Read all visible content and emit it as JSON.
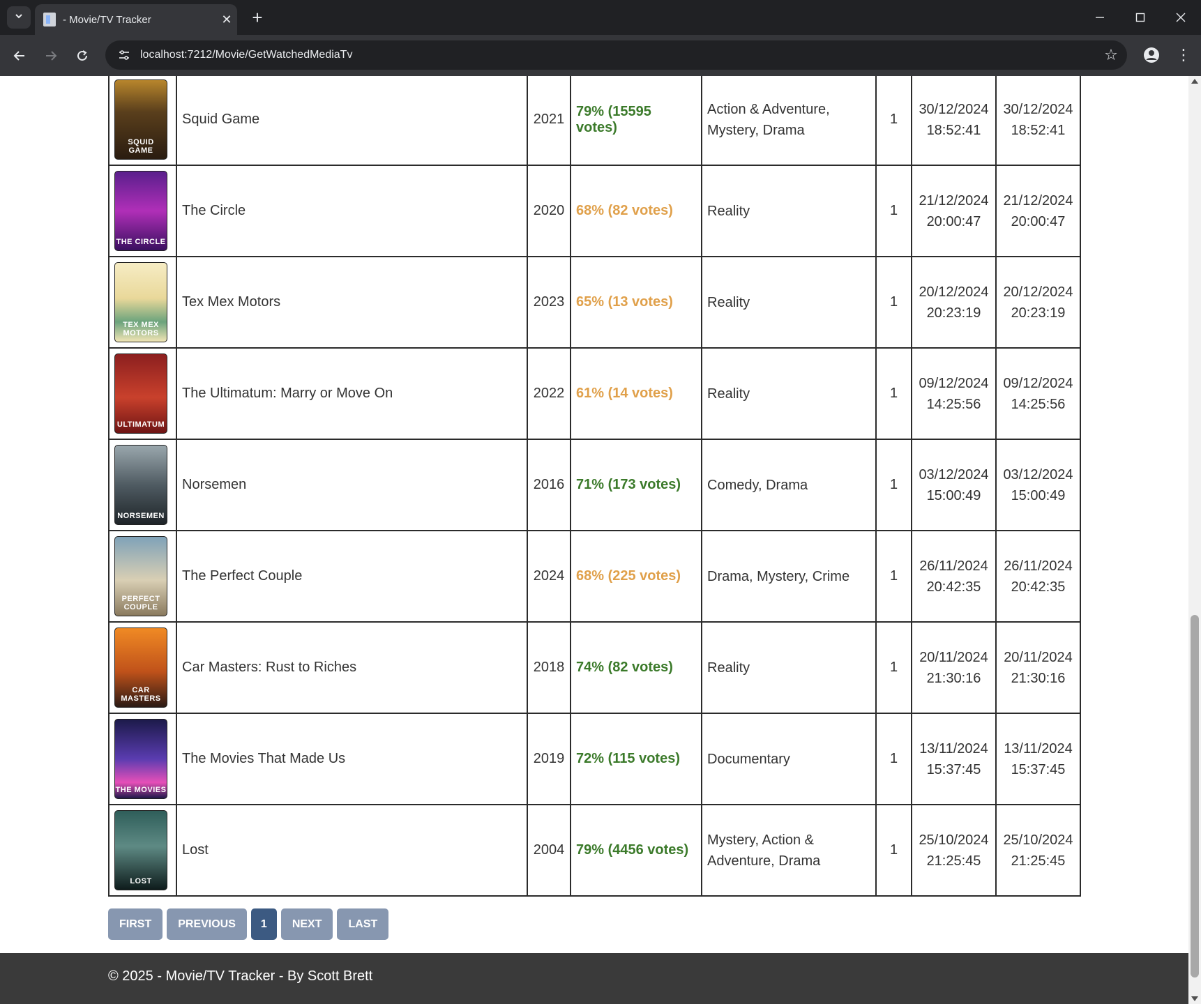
{
  "browser": {
    "tab_title": "- Movie/TV Tracker",
    "url": "localhost:7212/Movie/GetWatchedMediaTv",
    "new_tab_glyph": "+",
    "close_tab_glyph": "✕"
  },
  "rows": [
    {
      "title": "Squid Game",
      "year": "2021",
      "rating": "79% (15595 votes)",
      "rating_class": "good",
      "genres": "Action & Adventure, Mystery, Drama",
      "count": "1",
      "date1": "30/12/2024",
      "time1": "18:52:41",
      "date2": "30/12/2024",
      "time2": "18:52:41",
      "poster_bg": "linear-gradient(180deg,#b8862c 0%,#5a3f1c 40%,#2a1c10 100%)",
      "poster_text": "SQUID GAME"
    },
    {
      "title": "The Circle",
      "year": "2020",
      "rating": "68% (82 votes)",
      "rating_class": "ok",
      "genres": "Reality",
      "count": "1",
      "date1": "21/12/2024",
      "time1": "20:00:47",
      "date2": "21/12/2024",
      "time2": "20:00:47",
      "poster_bg": "linear-gradient(180deg,#5a1f8c 0%,#b02fb8 50%,#3a1060 100%)",
      "poster_text": "THE CIRCLE"
    },
    {
      "title": "Tex Mex Motors",
      "year": "2023",
      "rating": "65% (13 votes)",
      "rating_class": "ok",
      "genres": "Reality",
      "count": "1",
      "date1": "20/12/2024",
      "time1": "20:23:19",
      "date2": "20/12/2024",
      "time2": "20:23:19",
      "poster_bg": "linear-gradient(180deg,#f6ecc4 0%,#e9d89a 45%,#6ba37c 75%,#f1e5b5 100%)",
      "poster_text": "TEX MEX MOTORS"
    },
    {
      "title": "The Ultimatum: Marry or Move On",
      "year": "2022",
      "rating": "61% (14 votes)",
      "rating_class": "ok",
      "genres": "Reality",
      "count": "1",
      "date1": "09/12/2024",
      "time1": "14:25:56",
      "date2": "09/12/2024",
      "time2": "14:25:56",
      "poster_bg": "linear-gradient(180deg,#8c1f1f 0%,#c9412c 55%,#6e1414 100%)",
      "poster_text": "ULTIMATUM"
    },
    {
      "title": "Norsemen",
      "year": "2016",
      "rating": "71% (173 votes)",
      "rating_class": "good",
      "genres": "Comedy, Drama",
      "count": "1",
      "date1": "03/12/2024",
      "time1": "15:00:49",
      "date2": "03/12/2024",
      "time2": "15:00:49",
      "poster_bg": "linear-gradient(180deg,#9aa7ad 0%,#4f5b62 50%,#1e2428 100%)",
      "poster_text": "NORSEMEN"
    },
    {
      "title": "The Perfect Couple",
      "year": "2024",
      "rating": "68% (225 votes)",
      "rating_class": "ok",
      "genres": "Drama, Mystery, Crime",
      "count": "1",
      "date1": "26/11/2024",
      "time1": "20:42:35",
      "date2": "26/11/2024",
      "time2": "20:42:35",
      "poster_bg": "linear-gradient(180deg,#7fa2b8 0%,#d9cfb4 55%,#8a7a5e 100%)",
      "poster_text": "PERFECT COUPLE"
    },
    {
      "title": "Car Masters: Rust to Riches",
      "year": "2018",
      "rating": "74% (82 votes)",
      "rating_class": "good",
      "genres": "Reality",
      "count": "1",
      "date1": "20/11/2024",
      "time1": "21:30:16",
      "date2": "20/11/2024",
      "time2": "21:30:16",
      "poster_bg": "linear-gradient(180deg,#f08a24 0%,#c0521a 55%,#2b1a14 100%)",
      "poster_text": "CAR MASTERS"
    },
    {
      "title": "The Movies That Made Us",
      "year": "2019",
      "rating": "72% (115 votes)",
      "rating_class": "good",
      "genres": "Documentary",
      "count": "1",
      "date1": "13/11/2024",
      "time1": "15:37:45",
      "date2": "13/11/2024",
      "time2": "15:37:45",
      "poster_bg": "linear-gradient(180deg,#1c1a4a 0%,#5a3cb0 50%,#e64fb8 80%,#20184a 100%)",
      "poster_text": "THE MOVIES"
    },
    {
      "title": "Lost",
      "year": "2004",
      "rating": "79% (4456 votes)",
      "rating_class": "good",
      "genres": "Mystery, Action & Adventure, Drama",
      "count": "1",
      "date1": "25/10/2024",
      "time1": "21:25:45",
      "date2": "25/10/2024",
      "time2": "21:25:45",
      "poster_bg": "linear-gradient(180deg,#2f5e5a 0%,#5e8a84 45%,#0e1c1c 100%)",
      "poster_text": "LOST"
    }
  ],
  "pagination": {
    "first": "FIRST",
    "previous": "PREVIOUS",
    "current": "1",
    "next": "NEXT",
    "last": "LAST"
  },
  "footer": {
    "text": "© 2025 - Movie/TV Tracker - By Scott Brett"
  },
  "colors": {
    "rating_good": "#3b7a2a",
    "rating_ok": "#e0a04a",
    "pager_button": "#8797b0",
    "pager_active": "#3c5a82",
    "footer_bg": "#3a3a3a"
  }
}
